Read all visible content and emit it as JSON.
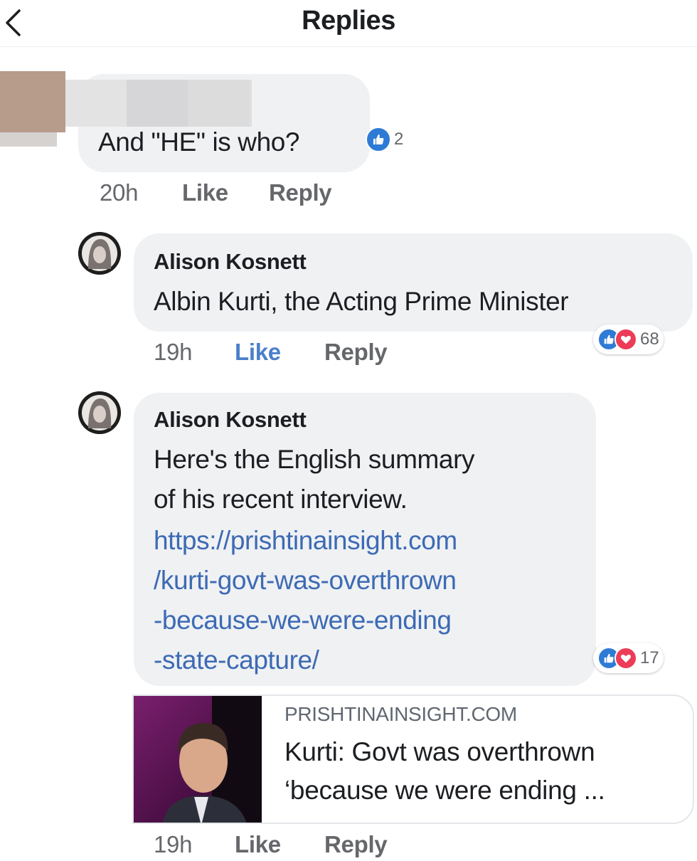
{
  "header": {
    "title": "Replies"
  },
  "comments": [
    {
      "text": "And \"HE\" is who?",
      "reaction_count": "2",
      "time": "20h",
      "like_label": "Like",
      "reply_label": "Reply"
    },
    {
      "author": "Alison Kosnett",
      "text": "Albin Kurti, the Acting Prime Minister",
      "reaction_count": "68",
      "time": "19h",
      "like_label": "Like",
      "reply_label": "Reply"
    },
    {
      "author": "Alison Kosnett",
      "text_lines": [
        "Here's the English summary",
        "of his recent interview."
      ],
      "link_lines": [
        "https://prishtinainsight.com",
        "/kurti-govt-was-overthrown",
        "-because-we-were-ending",
        "-state-capture/"
      ],
      "reaction_count": "17",
      "time": "19h",
      "like_label": "Like",
      "reply_label": "Reply",
      "preview": {
        "domain": "PRISHTINAINSIGHT.COM",
        "title_lines": [
          "Kurti: Govt was overthrown",
          "‘because we were ending ..."
        ]
      }
    }
  ],
  "colors": {
    "like_blue": "#2e7bd6",
    "love_red": "#ec3c57",
    "link": "#3d6ab4",
    "bubble": "#eff1f3"
  }
}
